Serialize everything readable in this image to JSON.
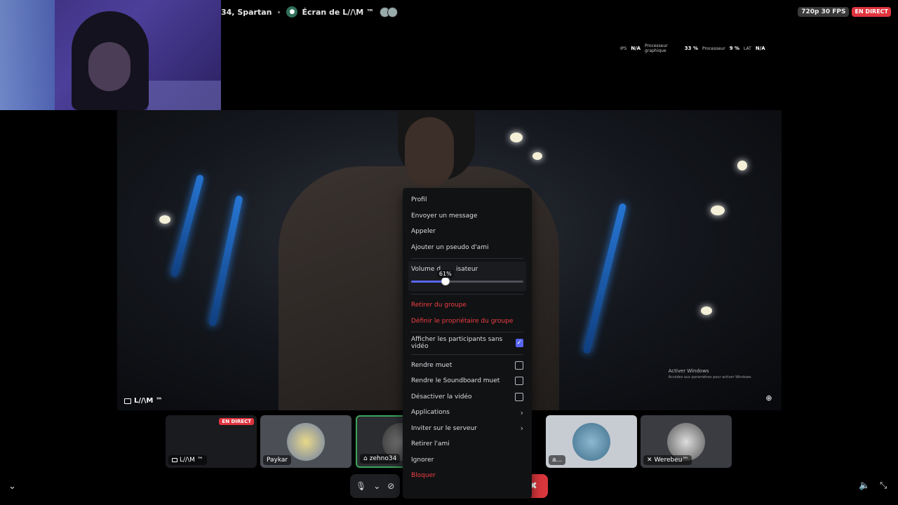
{
  "header": {
    "call_name": "34, Spartan",
    "stream_title": "Écran de L//\\M ™",
    "quality": "720p 30 FPS",
    "live_label": "EN DIRECT"
  },
  "stats": {
    "fps_label": "IPS",
    "fps_value": "N/A",
    "gpu_label_1": "Processeur",
    "gpu_label_2": "graphique",
    "gpu_value": "33 %",
    "cpu_label": "Processeur",
    "cpu_value": "9 %",
    "lat_label": "LAT",
    "lat_value": "N/A"
  },
  "main_stream": {
    "label": "L//\\M ™",
    "watermark_title": "Activer Windows",
    "watermark_sub": "Accédez aux paramètres pour activer Windows."
  },
  "thumbnails": [
    {
      "name": "L//\\M ™",
      "live": "EN DIRECT",
      "icon": "monitor-icon"
    },
    {
      "name": "Paykar"
    },
    {
      "name": "zehno34",
      "icon": "playstation-icon"
    },
    {
      "name": "a..."
    },
    {
      "name": "Werebeu™",
      "icon": "mic-muted-icon"
    }
  ],
  "menu": {
    "profile": "Profil",
    "message": "Envoyer un message",
    "call": "Appeler",
    "nickname": "Ajouter un pseudo d'ami",
    "volume_label_a": "Volume d",
    "volume_label_b": "isateur",
    "volume_value": "61%",
    "volume_fraction": 0.61,
    "remove_group": "Retirer du groupe",
    "set_owner": "Définir le propriétaire du groupe",
    "show_no_video": "Afficher les participants sans vidéo",
    "show_no_video_checked": true,
    "mute": "Rendre muet",
    "mute_soundboard": "Rendre le Soundboard muet",
    "disable_video": "Désactiver la vidéo",
    "apps": "Applications",
    "invite": "Inviter sur le serveur",
    "remove_friend": "Retirer l'ami",
    "ignore": "Ignorer",
    "block": "Bloquer"
  },
  "colors": {
    "accent": "#5865f2",
    "danger": "#f23f43",
    "live": "#e0343f"
  }
}
